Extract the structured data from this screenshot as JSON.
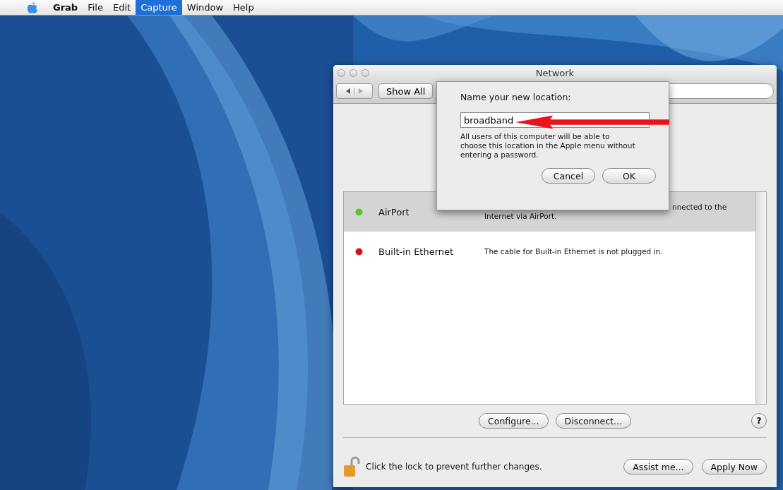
{
  "menu_bar": {
    "items": [
      {
        "label": "Grab",
        "kind": "app",
        "selected": false
      },
      {
        "label": "File",
        "kind": "menu",
        "selected": false
      },
      {
        "label": "Edit",
        "kind": "menu",
        "selected": false
      },
      {
        "label": "Capture",
        "kind": "menu",
        "selected": true
      },
      {
        "label": "Window",
        "kind": "menu",
        "selected": false
      },
      {
        "label": "Help",
        "kind": "menu",
        "selected": false
      }
    ]
  },
  "window": {
    "title": "Network",
    "show_all": "Show All",
    "services": [
      {
        "name": "AirPort",
        "color": "#5cc13a",
        "selected": true,
        "lines": [
          {
            "text": "nnected to the",
            "covered": true
          },
          {
            "text": "Internet via AirPort.",
            "covered": false
          }
        ]
      },
      {
        "name": "Built-in Ethernet",
        "color": "#d0151b",
        "selected": false,
        "lines": [
          {
            "text": "The cable for Built-in Ethernet is not plugged in.",
            "covered": false
          }
        ]
      }
    ],
    "service_buttons": [
      "Configure...",
      "Disconnect..."
    ],
    "help": "?",
    "locked": false,
    "lock_text": "Click the lock to prevent further changes.",
    "buttons": [
      "Assist me...",
      "Apply Now"
    ]
  },
  "dialog": {
    "prompt": "Name your new location:",
    "value": "broadband",
    "note": "All users of this computer will be able to choose this location in the Apple menu without entering a password.",
    "buttons": [
      {
        "label": "Cancel",
        "default": false
      },
      {
        "label": "OK",
        "default": false
      }
    ]
  }
}
